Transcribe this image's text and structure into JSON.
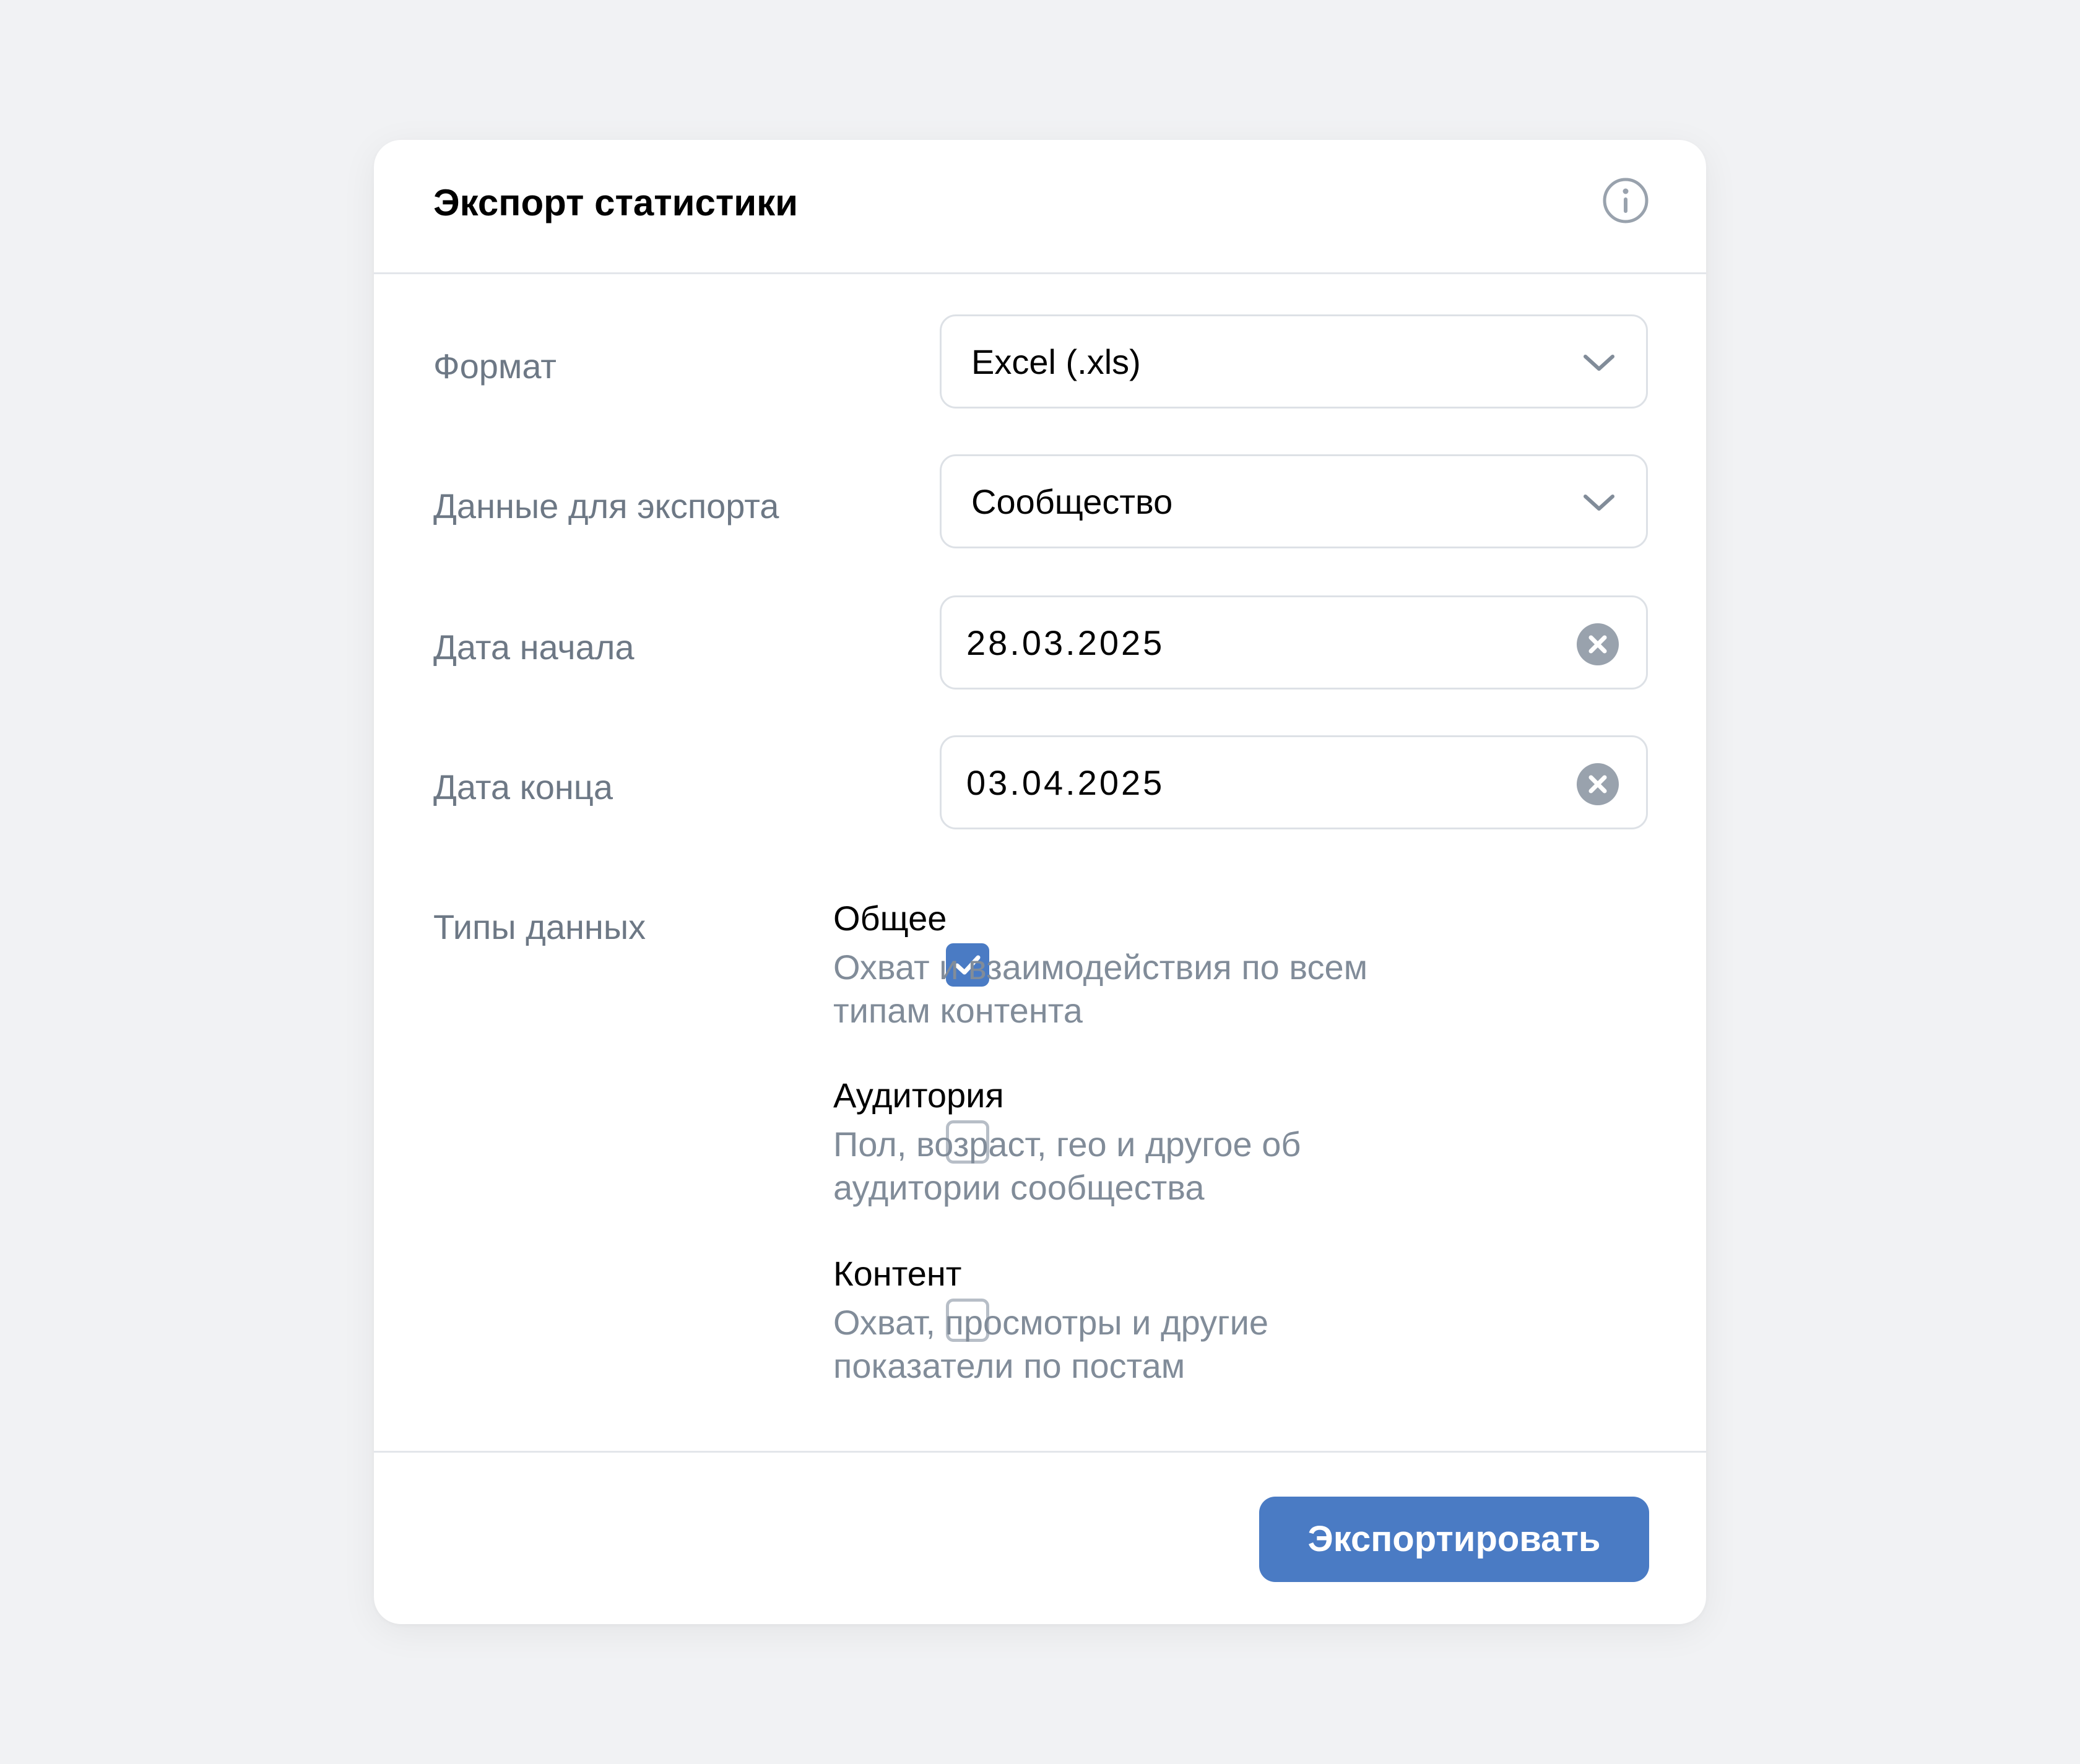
{
  "dialog": {
    "title": "Экспорт статистики",
    "info_icon": "info-icon"
  },
  "form": {
    "format": {
      "label": "Формат",
      "value": "Excel (.xls)",
      "icon": "chevron-down-icon"
    },
    "data_source": {
      "label": "Данные для экспорта",
      "value": "Сообщество",
      "icon": "chevron-down-icon"
    },
    "start_date": {
      "label": "Дата начала",
      "value": "28.03.2025",
      "icon": "clear-icon"
    },
    "end_date": {
      "label": "Дата конца",
      "value": "03.04.2025",
      "icon": "clear-icon"
    },
    "data_types": {
      "label": "Типы данных",
      "options": [
        {
          "title": "Общее",
          "description": "Охват и взаимодействия по всем типам контента",
          "checked": true
        },
        {
          "title": "Аудитория",
          "description": "Пол, возраст, гео и другое об аудитории сообщества",
          "checked": false
        },
        {
          "title": "Контент",
          "description": "Охват, просмотры и другие показатели по постам",
          "checked": false
        }
      ]
    }
  },
  "footer": {
    "export_label": "Экспортировать"
  },
  "colors": {
    "accent": "#4a7bc4",
    "background": "#f1f2f4",
    "label_text": "#6d7885",
    "secondary_text": "#818c99",
    "icon_gray": "#99a2ad"
  }
}
